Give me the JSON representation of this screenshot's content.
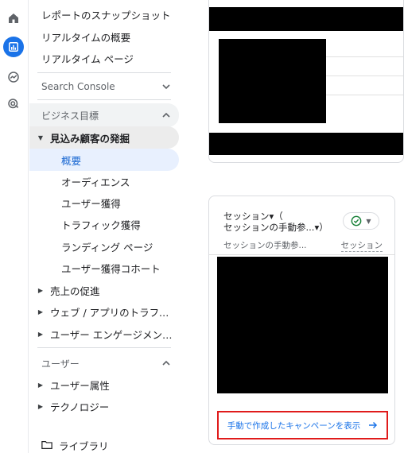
{
  "nav": {
    "top_items": [
      "レポートのスナップショット",
      "リアルタイムの概要",
      "リアルタイム ページ"
    ],
    "search_console": "Search Console",
    "business_goals": "ビジネス目標",
    "lead_generation": "見込み顧客の発掘",
    "lead_children": [
      "概要",
      "オーディエンス",
      "ユーザー獲得",
      "トラフィック獲得",
      "ランディング ページ",
      "ユーザー獲得コホート"
    ],
    "collapsed_groups": [
      "売上の促進",
      "ウェブ / アプリのトラフィック...",
      "ユーザー エンゲージメントと..."
    ],
    "user_section": "ユーザー",
    "user_groups": [
      "ユーザー属性",
      "テクノロジー"
    ],
    "library": "ライブラリ"
  },
  "session_card": {
    "title_line1": "セッション▾（",
    "title_line2": "セッションの手動参...▾）",
    "col_left": "セッションの手動参...",
    "col_right": "セッション",
    "link_text": "手動で作成したキャンペーンを表示"
  },
  "colors": {
    "accent": "#1a73e8",
    "highlight_border": "#e01b1b",
    "check_green": "#188038"
  }
}
